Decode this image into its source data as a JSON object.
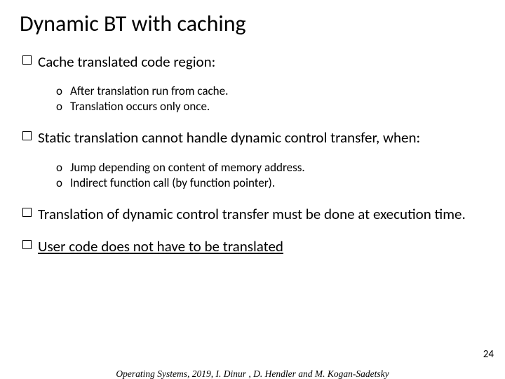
{
  "title": "Dynamic BT with caching",
  "blocks": [
    {
      "text": "Cache translated code region:",
      "subs": [
        "After translation run from cache.",
        "Translation occurs only once."
      ]
    },
    {
      "text": "Static translation cannot handle dynamic control transfer, when:",
      "subs": [
        "Jump depending on content of memory address.",
        "Indirect function call (by function pointer)."
      ]
    },
    {
      "text": "Translation of dynamic control transfer must be done at execution time.",
      "subs": []
    },
    {
      "text": "User code does not have to be translated",
      "underline": true,
      "subs": []
    }
  ],
  "page_number": "24",
  "footer": "Operating Systems, 2019, I. Dinur , D. Hendler and M. Kogan-Sadetsky"
}
